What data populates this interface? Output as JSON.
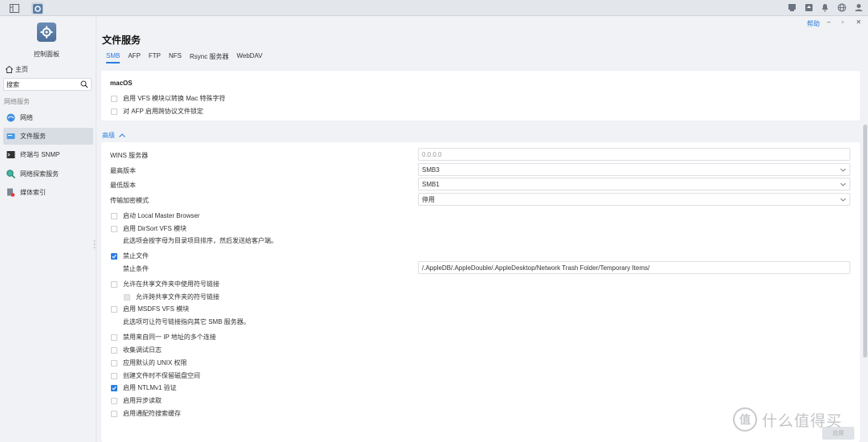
{
  "topbar": {
    "icons": [
      "window-switch-icon",
      "control-panel-app-icon",
      "message-icon",
      "upload-icon",
      "bell-icon",
      "globe-icon",
      "user-icon"
    ]
  },
  "window": {
    "help": "帮助",
    "controls": [
      "minimize-icon",
      "restore-icon",
      "close-icon"
    ]
  },
  "sidebar": {
    "title": "控制面板",
    "home": "主页",
    "search_placeholder": "搜索",
    "section": "网络服务",
    "items": [
      {
        "label": "网络",
        "icon": "network-icon",
        "active": false
      },
      {
        "label": "文件服务",
        "icon": "file-service-icon",
        "active": true
      },
      {
        "label": "终端与 SNMP",
        "icon": "terminal-icon",
        "active": false
      },
      {
        "label": "网络探索服务",
        "icon": "network-discovery-icon",
        "active": false
      },
      {
        "label": "媒体索引",
        "icon": "media-index-icon",
        "active": false
      }
    ]
  },
  "main": {
    "title": "文件服务",
    "tabs": [
      "SMB",
      "AFP",
      "FTP",
      "NFS",
      "Rsync 服务器",
      "WebDAV"
    ],
    "active_tab": "SMB",
    "mac": {
      "title": "macOS",
      "options": [
        {
          "label": "启用 VFS 模块以转换 Mac 特殊字符",
          "checked": false
        },
        {
          "label": "对 AFP 启用跨协议文件锁定",
          "checked": false
        }
      ]
    },
    "advanced_label": "高级",
    "fields": {
      "wins_label": "WINS 服务器",
      "wins_placeholder": "0.0.0.0",
      "max_label": "最高版本",
      "max_value": "SMB3",
      "min_label": "最低版本",
      "min_value": "SMB1",
      "enc_label": "传输加密模式",
      "enc_value": "停用"
    },
    "options": {
      "local_master": "启动 Local Master Browser",
      "dirsort": "启用 DirSort VFS 模块",
      "dirsort_note": "此选项会按字母为目录项目排序，然后发送给客户端。",
      "veto": "禁止文件",
      "veto_cond_label": "禁止条件",
      "veto_cond_value": "/.AppleDB/.AppleDouble/.AppleDesktop/Network Trash Folder/Temporary Items/",
      "symlink": "允许在共享文件夹中使用符号链接",
      "symlink_cross": "允许跨共享文件夹的符号链接",
      "msdfs": "启用 MSDFS VFS 模块",
      "msdfs_note": "此选项可让符号链接指向其它 SMB 服务器。",
      "multi_conn": "禁用来自同一 IP 地址的多个连接",
      "debug_log": "收集调试日志",
      "unix_perm": "应用默认的 UNIX 权限",
      "no_reserve": "创建文件时不保留磁盘空间",
      "ntlmv1": "启用 NTLMv1 验证",
      "async_read": "启用异步读取",
      "wildcard_cache": "启用通配符搜索缓存"
    },
    "apply": "应用"
  },
  "watermark": {
    "mark": "值",
    "text": "什么值得买"
  },
  "colors": {
    "accent": "#2b7de0",
    "background": "#f0f2f5"
  }
}
